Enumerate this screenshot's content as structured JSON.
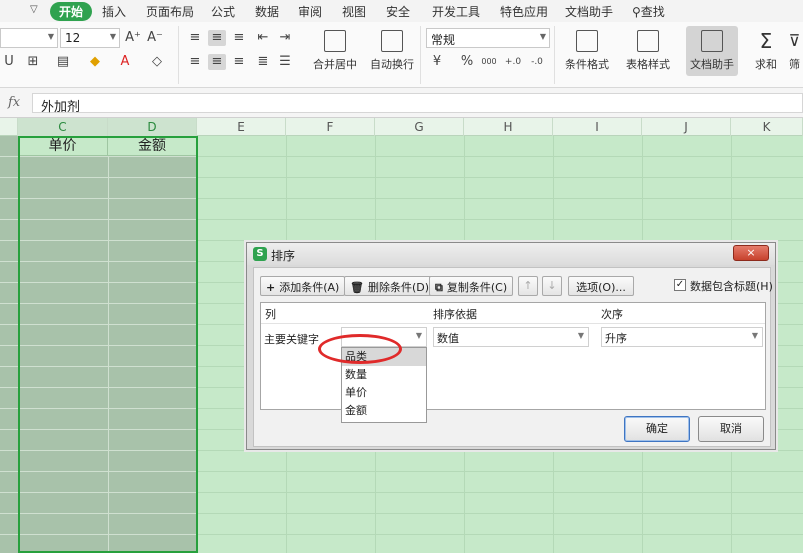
{
  "menu": {
    "items": [
      "开始",
      "插入",
      "页面布局",
      "公式",
      "数据",
      "审阅",
      "视图",
      "安全",
      "开发工具",
      "特色应用",
      "文档助手",
      "查找"
    ],
    "active_index": 0
  },
  "ribbon": {
    "font_size": "12",
    "number_format": "常规",
    "merge_label": "合并居中",
    "wrap_label": "自动换行",
    "cond_format_label": "条件格式",
    "table_style_label": "表格样式",
    "doc_helper_label": "文档助手",
    "sum_label": "求和",
    "filter_label": "筛",
    "grow_font": "A⁺",
    "shrink_font": "A⁻",
    "percent": "%",
    "thousands": "000",
    "inc_decimal": "+.0",
    "dec_decimal": "-.0"
  },
  "formula_bar": {
    "fx": "fx",
    "value": "外加剂"
  },
  "columns": [
    "C",
    "D",
    "E",
    "F",
    "G",
    "H",
    "I",
    "J",
    "K"
  ],
  "header_cells": {
    "c": "单价",
    "d": "金额"
  },
  "dialog": {
    "title": "排序",
    "logo": "S",
    "close": "×",
    "add_condition": "添加条件(A)",
    "delete_condition": "删除条件(D)",
    "copy_condition": "复制条件(C)",
    "up": "↑",
    "down": "↓",
    "options": "选项(O)...",
    "has_header_label": "数据包含标题(H)",
    "has_header_checked": true,
    "col_header": "列",
    "sort_on_header": "排序依据",
    "order_header": "次序",
    "primary_key_label": "主要关键字",
    "primary_key_value": "",
    "sort_on_value": "数值",
    "order_value": "升序",
    "dropdown_options": [
      "品类",
      "数量",
      "单价",
      "金额"
    ],
    "dropdown_highlight": 0,
    "ok": "确定",
    "cancel": "取消"
  }
}
